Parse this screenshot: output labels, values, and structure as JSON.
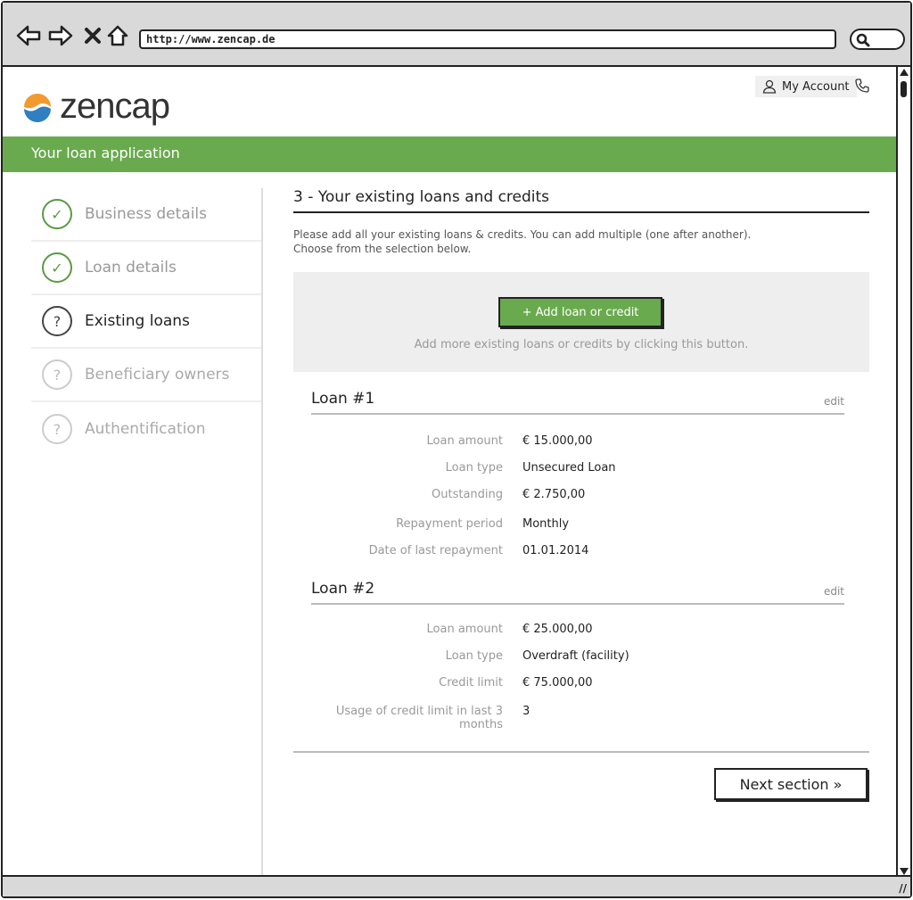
{
  "browser": {
    "url": "http://www.zencap.de"
  },
  "header": {
    "logo_text": "zencap",
    "account_label": "My Account",
    "banner_title": "Your loan application"
  },
  "sidebar": {
    "items": [
      {
        "label": "Business details",
        "state": "done",
        "mark": "✓"
      },
      {
        "label": "Loan details",
        "state": "done",
        "mark": "✓"
      },
      {
        "label": "Existing loans",
        "state": "current",
        "mark": "?"
      },
      {
        "label": "Beneficiary owners",
        "state": "todo",
        "mark": "?"
      },
      {
        "label": "Authentification",
        "state": "todo",
        "mark": "?"
      }
    ]
  },
  "main": {
    "section_title": "3 - Your existing loans and credits",
    "intro_line1": "Please add all your existing loans & credits. You can add multiple (one after another).",
    "intro_line2": "Choose from the selection below.",
    "add_button": "+ Add loan or credit",
    "add_hint": "Add more existing loans or credits by clicking this button.",
    "loans": [
      {
        "title": "Loan #1",
        "edit": "edit",
        "rows": [
          {
            "k": "Loan amount",
            "v": "€ 15.000,00"
          },
          {
            "k": "Loan type",
            "v": "Unsecured Loan"
          },
          {
            "k": "Outstanding",
            "v": "€ 2.750,00"
          },
          {
            "k": "Repayment period",
            "v": "Monthly"
          },
          {
            "k": "Date of last repayment",
            "v": "01.01.2014"
          }
        ]
      },
      {
        "title": "Loan #2",
        "edit": "edit",
        "rows": [
          {
            "k": "Loan amount",
            "v": "€ 25.000,00"
          },
          {
            "k": "Loan type",
            "v": "Overdraft (facility)"
          },
          {
            "k": "Credit limit",
            "v": "€ 75.000,00"
          },
          {
            "k": "Usage of credit limit in last 3 months",
            "v": "3"
          }
        ]
      }
    ],
    "next_button": "Next section »"
  },
  "colors": {
    "brand_green": "#6aaa4e",
    "logo_orange": "#f29a2e",
    "logo_blue": "#2f7fc1"
  }
}
